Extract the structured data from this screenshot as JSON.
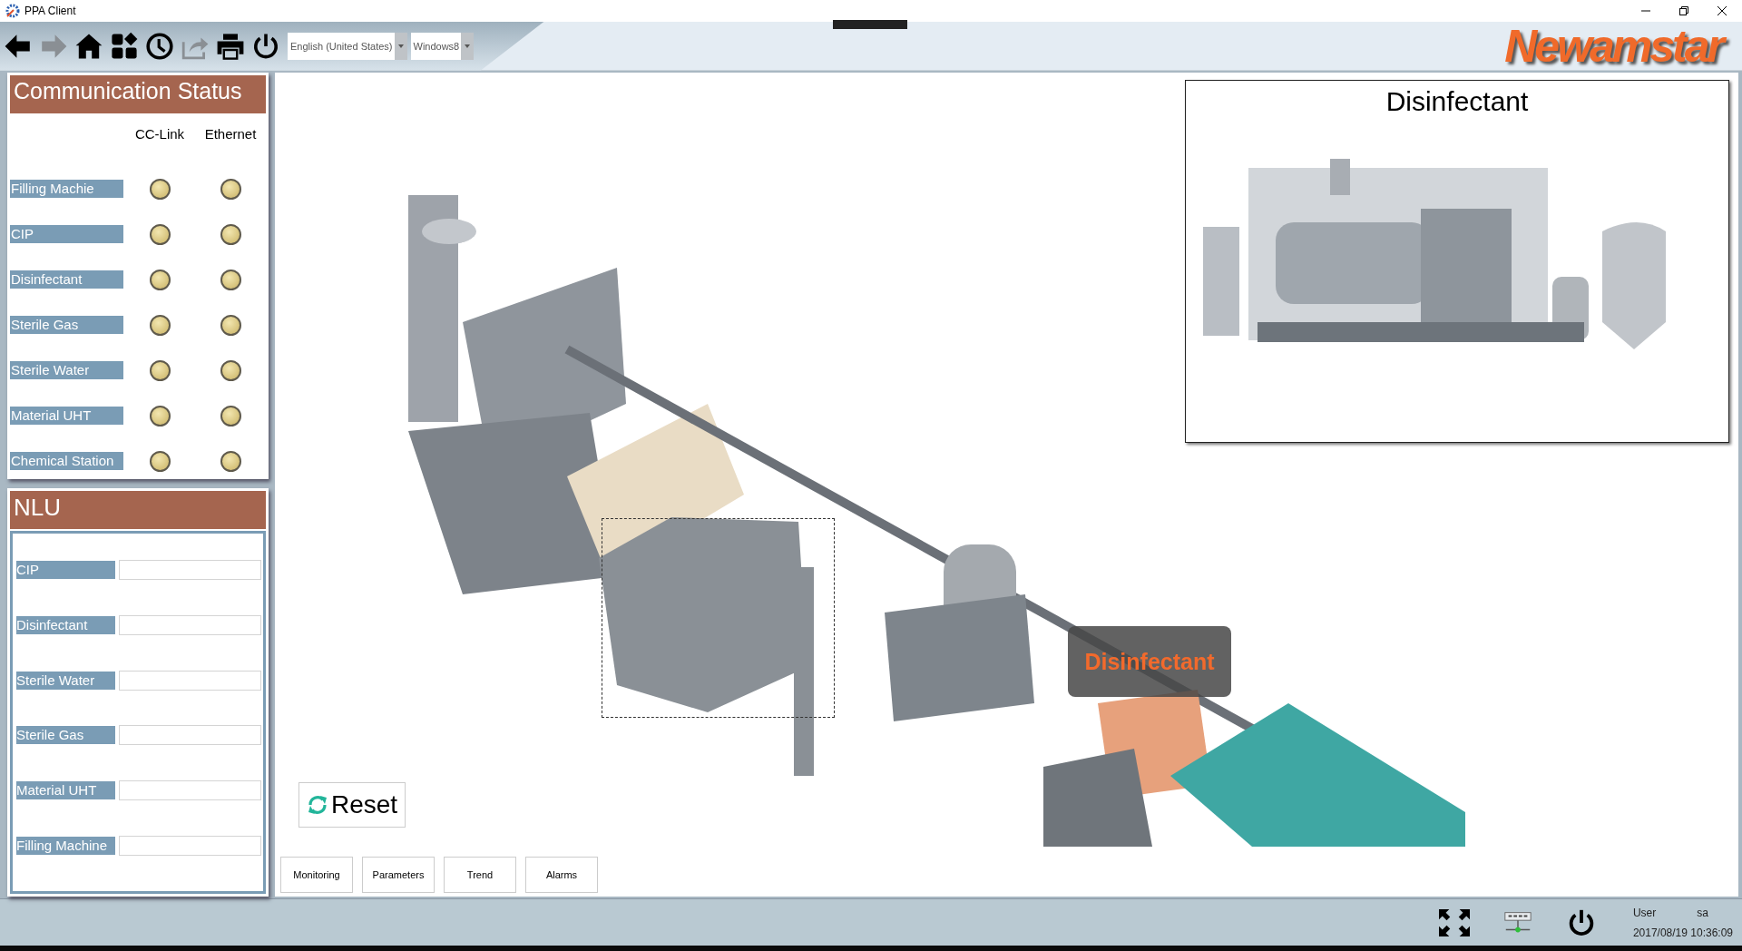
{
  "window": {
    "title": "PPA Client"
  },
  "toolbar": {
    "buttons": [
      {
        "kind": "back",
        "disabled": false
      },
      {
        "kind": "forward",
        "disabled": true
      },
      {
        "kind": "home",
        "disabled": false
      },
      {
        "kind": "apps",
        "disabled": false
      },
      {
        "kind": "history",
        "disabled": false
      },
      {
        "kind": "share",
        "disabled": true
      },
      {
        "kind": "print",
        "disabled": false
      },
      {
        "kind": "power",
        "disabled": false
      }
    ],
    "dropdowns": [
      {
        "value": "English (United States)"
      },
      {
        "value": "Windows8"
      }
    ],
    "logo": "Newamstar"
  },
  "communication_status": {
    "title": "Communication Status",
    "columns": [
      "CC-Link",
      "Ethernet"
    ],
    "rows": [
      {
        "label": "Filling Machie",
        "lamps": [
          {
            "on": false
          },
          {
            "on": false
          }
        ]
      },
      {
        "label": "CIP",
        "lamps": [
          {
            "on": false
          },
          {
            "on": false
          }
        ]
      },
      {
        "label": "Disinfectant",
        "lamps": [
          {
            "on": false
          },
          {
            "on": false
          }
        ]
      },
      {
        "label": "Sterile Gas",
        "lamps": [
          {
            "on": false
          },
          {
            "on": false
          }
        ]
      },
      {
        "label": "Sterile Water",
        "lamps": [
          {
            "on": false
          },
          {
            "on": false
          }
        ]
      },
      {
        "label": "Material UHT",
        "lamps": [
          {
            "on": false
          },
          {
            "on": false
          }
        ]
      },
      {
        "label": "Chemical Station",
        "lamps": [
          {
            "on": false
          },
          {
            "on": false
          }
        ]
      }
    ]
  },
  "nlu": {
    "title": "NLU",
    "rows": [
      {
        "label": "CIP"
      },
      {
        "label": "Disinfectant"
      },
      {
        "label": "Sterile Water"
      },
      {
        "label": "Sterile Gas"
      },
      {
        "label": "Material UHT"
      },
      {
        "label": "Filling Machine"
      }
    ]
  },
  "plant_view": {
    "inset": {
      "title": "Disinfectant"
    },
    "tooltip": "Disinfectant",
    "reset_button": "Reset"
  },
  "tabs": [
    {
      "label": "Monitoring",
      "selected": false
    },
    {
      "label": "Parameters",
      "selected": false
    },
    {
      "label": "Trend",
      "selected": false
    },
    {
      "label": "Alarms",
      "selected": false
    }
  ],
  "status_bar": {
    "icons": [
      {
        "kind": "fullscreen"
      },
      {
        "kind": "network"
      },
      {
        "kind": "power"
      }
    ],
    "user_label": "User",
    "user": "sa",
    "datetime": "2017/08/19 10:36:09"
  }
}
